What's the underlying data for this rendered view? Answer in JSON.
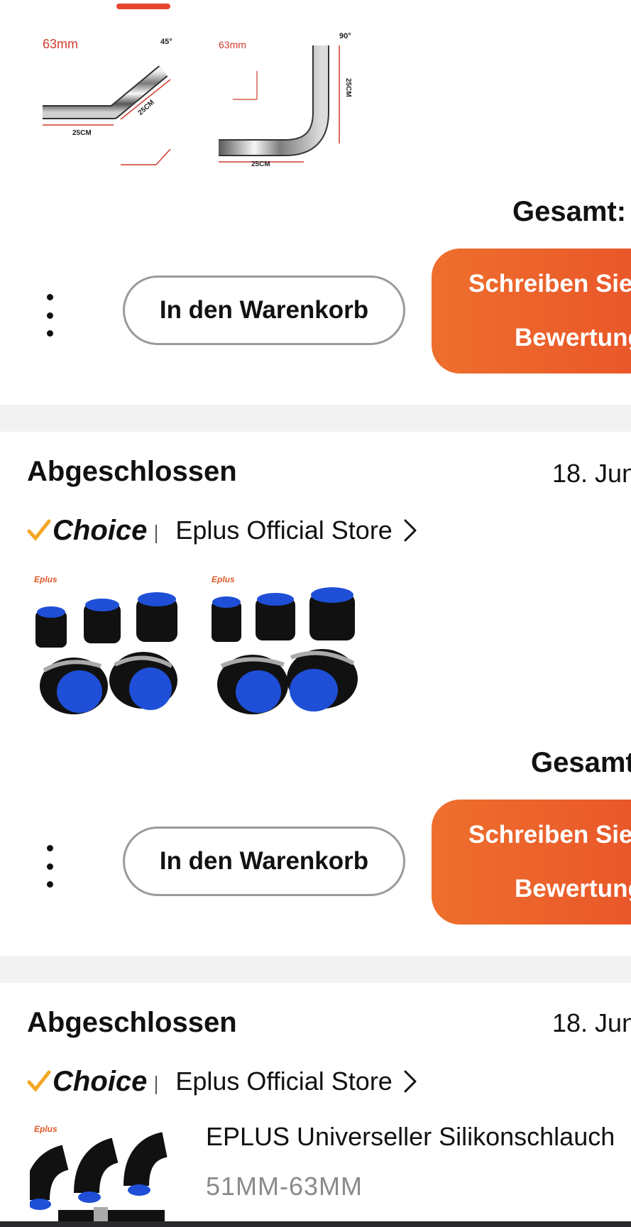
{
  "order1": {
    "images": [
      {
        "label_size": "63mm",
        "label_angle": "45°",
        "dim_a": "25CM",
        "dim_b": "25CM"
      },
      {
        "label_size": "63mm",
        "label_angle": "90°",
        "dim_a": "25CM",
        "dim_b": "25CM"
      }
    ],
    "total_label": "Gesamt:",
    "cart_button": "In den Warenkorb",
    "review_button_line1": "Schreiben Sie",
    "review_button_line2": "Bewertung"
  },
  "order2": {
    "status": "Abgeschlossen",
    "date": "18. Jun",
    "choice_label": "Choice",
    "store_name": "Eplus Official Store",
    "brand_mark": "Eplus",
    "total_label": "Gesamt",
    "cart_button": "In den Warenkorb",
    "review_button_line1": "Schreiben Sie",
    "review_button_line2": "Bewertung"
  },
  "order3": {
    "status": "Abgeschlossen",
    "date": "18. Jun",
    "choice_label": "Choice",
    "store_name": "Eplus Official Store",
    "brand_mark": "Eplus",
    "product_title": "EPLUS Universeller Silikonschlauch",
    "product_subtitle": "51MM-63MM"
  },
  "colors": {
    "accent": "#e8452f",
    "review_gradient_start": "#ee6f2d",
    "review_gradient_end": "#e5482a",
    "choice_check": "#f5a623",
    "hose_black": "#111111",
    "hose_blue": "#1e4fd6"
  },
  "icons": [
    "more-vertical-icon",
    "chevron-right-icon",
    "choice-check-icon"
  ]
}
